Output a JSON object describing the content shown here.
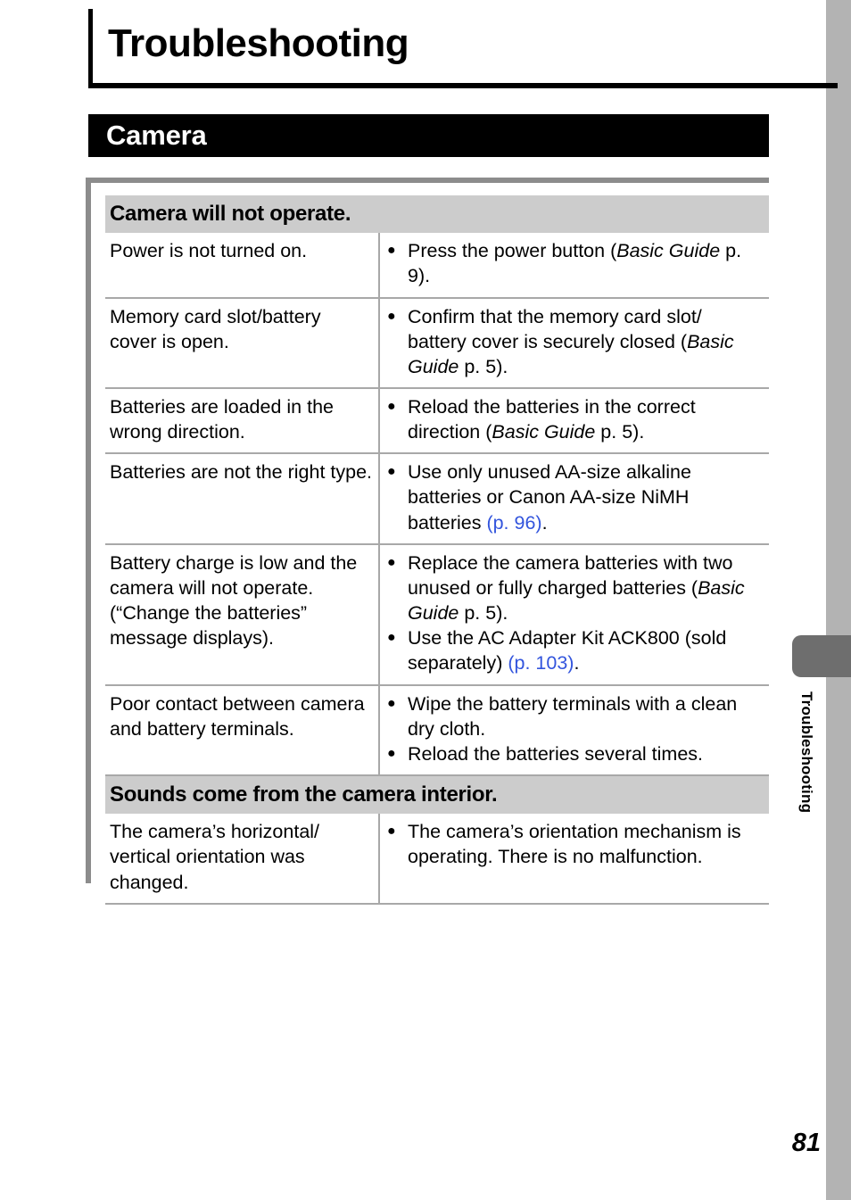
{
  "page": {
    "title": "Troubleshooting",
    "folio": "81",
    "side_tab_label": "Troubleshooting",
    "section_heading": "Camera",
    "link_color": "#3355dd"
  },
  "groups": [
    {
      "heading": "Camera will not operate.",
      "rows": [
        {
          "cause": "Power is not turned on.",
          "actions": [
            [
              {
                "t": "text",
                "v": "Press the power button ("
              },
              {
                "t": "italic",
                "v": "Basic Guide"
              },
              {
                "t": "text",
                "v": " p. 9)."
              }
            ]
          ]
        },
        {
          "cause": "Memory card slot/battery cover is open.",
          "actions": [
            [
              {
                "t": "text",
                "v": "Confirm that the memory card slot/ battery cover is securely closed ("
              },
              {
                "t": "italic",
                "v": "Basic Guide"
              },
              {
                "t": "text",
                "v": " p. 5)."
              }
            ]
          ]
        },
        {
          "cause": "Batteries are loaded in the wrong direction.",
          "actions": [
            [
              {
                "t": "text",
                "v": "Reload the batteries in the correct direction ("
              },
              {
                "t": "italic",
                "v": "Basic Guide"
              },
              {
                "t": "text",
                "v": " p. 5)."
              }
            ]
          ]
        },
        {
          "cause": "Batteries are not the right type.",
          "actions": [
            [
              {
                "t": "text",
                "v": "Use only unused AA-size alkaline batteries or Canon AA-size NiMH batteries "
              },
              {
                "t": "ref",
                "v": "(p. 96)"
              },
              {
                "t": "text",
                "v": "."
              }
            ]
          ]
        },
        {
          "cause": "Battery charge is low and the camera will not operate. (“Change the batteries” message displays).",
          "actions": [
            [
              {
                "t": "text",
                "v": "Replace the camera batteries with two unused or fully charged batteries ("
              },
              {
                "t": "italic",
                "v": "Basic Guide"
              },
              {
                "t": "text",
                "v": " p. 5)."
              }
            ],
            [
              {
                "t": "text",
                "v": "Use the AC Adapter Kit ACK800 (sold separately) "
              },
              {
                "t": "ref",
                "v": "(p. 103)"
              },
              {
                "t": "text",
                "v": "."
              }
            ]
          ]
        },
        {
          "cause": "Poor contact between camera and battery terminals.",
          "actions": [
            [
              {
                "t": "text",
                "v": "Wipe the battery terminals with a clean dry cloth."
              }
            ],
            [
              {
                "t": "text",
                "v": "Reload the batteries several times."
              }
            ]
          ]
        }
      ]
    },
    {
      "heading": "Sounds come from the camera interior.",
      "rows": [
        {
          "cause": "The camera’s horizontal/ vertical orientation was changed.",
          "actions": [
            [
              {
                "t": "text",
                "v": "The camera’s orientation mechanism is operating. There is no malfunction."
              }
            ]
          ]
        }
      ]
    }
  ]
}
